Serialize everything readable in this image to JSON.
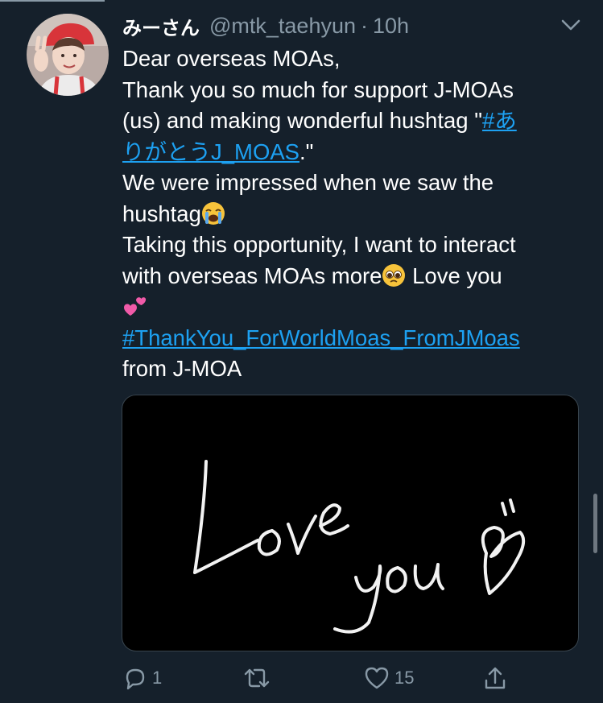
{
  "tweet": {
    "display_name": "みーさん",
    "handle": "@mtk_taehyun",
    "separator": "·",
    "time": "10h",
    "lines": {
      "l1": "Dear overseas MOAs,",
      "l2": "Thank you so much for support J-MOAs",
      "l3_pre": "(us) and making wonderful hushtag \"",
      "l3_link": "#あ",
      "l4_link": "りがとうJ_MOAS",
      "l4_post": ".\"",
      "l5": "We were impressed when we saw the",
      "l6": "hushtag",
      "l7": "Taking this opportunity, I want to interact",
      "l8_pre": "with overseas MOAs more",
      "l8_post": " Love you",
      "l10_link": "#ThankYou_ForWorldMoas_FromJMoas",
      "l11": "from J-MOA"
    },
    "media": {
      "image_text": "Love you"
    },
    "actions": {
      "reply_count": "1",
      "like_count": "15"
    }
  },
  "icons": {
    "caret": "chevron-down-icon",
    "reply": "reply-icon",
    "retweet": "retweet-icon",
    "like": "heart-icon",
    "share": "share-icon",
    "crying": "loudly-crying-face-icon",
    "pleading": "pleading-face-icon",
    "hearts": "two-hearts-icon"
  },
  "colors": {
    "background": "#15202b",
    "link": "#1da1f2",
    "muted": "#8899a6",
    "text": "#ffffff"
  }
}
